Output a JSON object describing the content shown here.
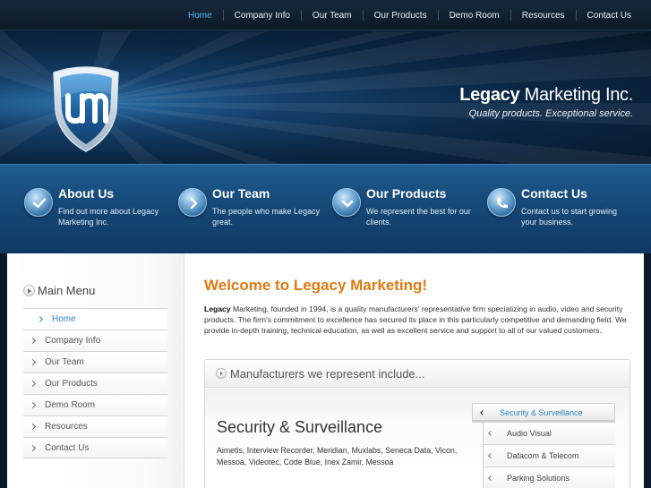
{
  "nav": {
    "items": [
      {
        "label": "Home",
        "active": true
      },
      {
        "label": "Company Info"
      },
      {
        "label": "Our Team"
      },
      {
        "label": "Our Products"
      },
      {
        "label": "Demo Room"
      },
      {
        "label": "Resources"
      },
      {
        "label": "Contact Us"
      }
    ]
  },
  "header": {
    "logo_text": "um",
    "brand_bold": "Legacy",
    "brand_rest": "Marketing Inc.",
    "tagline": "Quality products. Exceptional service."
  },
  "features": [
    {
      "title": "About Us",
      "desc": "Find out more about Legacy Marketing Inc.",
      "icon": "check-icon"
    },
    {
      "title": "Our Team",
      "desc": "The people who make Legacy great.",
      "icon": "arrow-right-icon"
    },
    {
      "title": "Our Products",
      "desc": "We represent the best for our clients.",
      "icon": "arrow-down-icon"
    },
    {
      "title": "Contact Us",
      "desc": "Contact us to start growing your business.",
      "icon": "phone-icon"
    }
  ],
  "sidebar": {
    "title": "Main Menu",
    "items": [
      {
        "label": "Home",
        "active": true
      },
      {
        "label": "Company Info"
      },
      {
        "label": "Our Team"
      },
      {
        "label": "Our Products"
      },
      {
        "label": "Demo Room"
      },
      {
        "label": "Resources"
      },
      {
        "label": "Contact Us"
      }
    ]
  },
  "main": {
    "welcome": "Welcome to Legacy Marketing!",
    "intro_bold": "Legacy",
    "intro_rest": " Marketing, founded in 1994, is a quality manufacturers' representative firm specializing in audio, video and security products. The firm's commitment to excellence has secured its place in this particularly competitive and demanding field. We provide in-depth training, technical education, as well as excellent service and support to all of our valued customers.",
    "manufacturers_heading": "Manufacturers we represent include...",
    "category_title": "Security & Surveillance",
    "category_list": "Aimetis, Interview Recorder, Meridian, Muxlabs, Seneca Data, Vicon, Messoa, Videotec, Code Blue, Inex Zamir, Messoa",
    "tabs": [
      {
        "label": "Security & Surveillance",
        "selected": true
      },
      {
        "label": "Audio Visual"
      },
      {
        "label": "Datacom & Telecom"
      },
      {
        "label": "Parking Solutions"
      }
    ]
  },
  "colors": {
    "accent_blue": "#2d86c2",
    "nav_active": "#4fb4f2",
    "welcome_orange": "#e07a12"
  }
}
